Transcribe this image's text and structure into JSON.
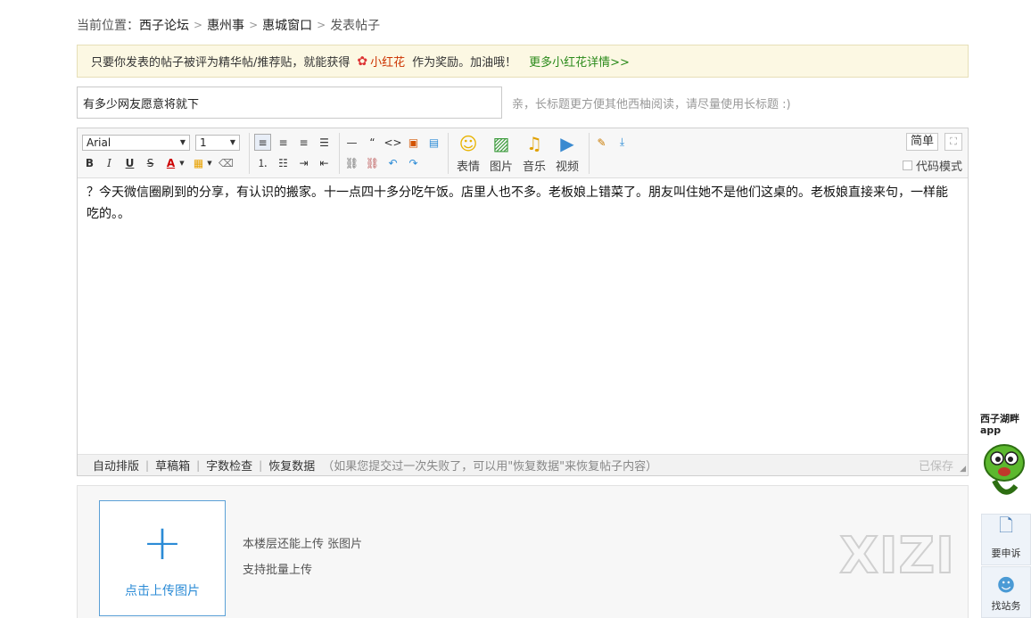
{
  "breadcrumb": {
    "prefix": "当前位置：",
    "items": [
      "西子论坛",
      "惠州事",
      "惠城窗口"
    ],
    "current": "发表帖子"
  },
  "notice": {
    "text_before": "只要你发表的帖子被评为精华帖/推荐贴，就能获得",
    "flower_label": "小红花",
    "text_after": "作为奖励。加油哦！",
    "more_link": "更多小红花详情>>"
  },
  "title_field": {
    "value": "有多少网友愿意将就下",
    "tip": "亲，长标题更方便其他西柚阅读，请尽量使用长标题 :)"
  },
  "toolbar": {
    "font_family": "Arial",
    "font_size": "1",
    "big_buttons": [
      {
        "label": "表情",
        "icon": "smiley-icon"
      },
      {
        "label": "图片",
        "icon": "image-icon"
      },
      {
        "label": "音乐",
        "icon": "music-icon"
      },
      {
        "label": "视频",
        "icon": "video-icon"
      }
    ],
    "simple_label": "简单",
    "code_mode_label": "代码模式"
  },
  "editor": {
    "content": "？今天微信圈刷到的分享，有认识的搬家。十一点四十多分吃午饭。店里人也不多。老板娘上错菜了。朋友叫住她不是他们这桌的。老板娘直接来句，一样能吃的。。"
  },
  "statusbar": {
    "links": [
      "自动排版",
      "草稿箱",
      "字数检查",
      "恢复数据"
    ],
    "hint": "（如果您提交过一次失败了，可以用\"恢复数据\"来恢复帖子内容）",
    "saved": "已保存"
  },
  "upload": {
    "button_label": "点击上传图片",
    "info_line1": "本楼层还能上传 张图片",
    "info_line2": "支持批量上传",
    "watermark": "XIZI"
  },
  "side": {
    "app_title_line1": "西子湖畔",
    "app_title_line2": "app",
    "complain_label": "要申诉",
    "service_label": "找站务"
  },
  "colors": {
    "link_green": "#2a8a1a",
    "accent_blue": "#2b8bd6",
    "notice_bg": "#fcf8e3"
  }
}
